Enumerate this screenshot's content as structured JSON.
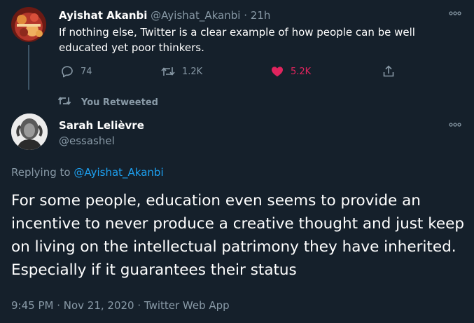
{
  "colors": {
    "background": "#15202b",
    "primary_text": "#ffffff",
    "secondary_text": "#8899a6",
    "link": "#1da1f2",
    "like": "#e0245e",
    "thread_line": "#3d5466"
  },
  "parent_tweet": {
    "author_name": "Ayishat Akanbi",
    "author_handle": "@Ayishat_Akanbi",
    "separator": "·",
    "time": "21h",
    "text": "If nothing else, Twitter is a clear example of how people can be well educated yet poor thinkers.",
    "more_icon": "more-icon",
    "actions": {
      "reply": {
        "icon": "reply-icon",
        "count": "74"
      },
      "retweet": {
        "icon": "retweet-icon",
        "count": "1.2K"
      },
      "like": {
        "icon": "heart-filled-icon",
        "count": "5.2K",
        "liked": true
      },
      "share": {
        "icon": "share-icon"
      }
    }
  },
  "retweet_context": {
    "icon": "retweet-icon",
    "label": "You Retweeted"
  },
  "main_tweet": {
    "author_name": "Sarah Lelièvre",
    "author_handle": "@essashel",
    "more_icon": "more-icon",
    "replying_prefix": "Replying to",
    "replying_to": "@Ayishat_Akanbi",
    "text": "For some people, education even seems to provide an incentive to never produce a creative thought and just keep on living on the intellectual patrimony they have inherited. Especially if it guarantees their status",
    "meta": "9:45 PM · Nov 21, 2020 · Twitter Web App"
  }
}
